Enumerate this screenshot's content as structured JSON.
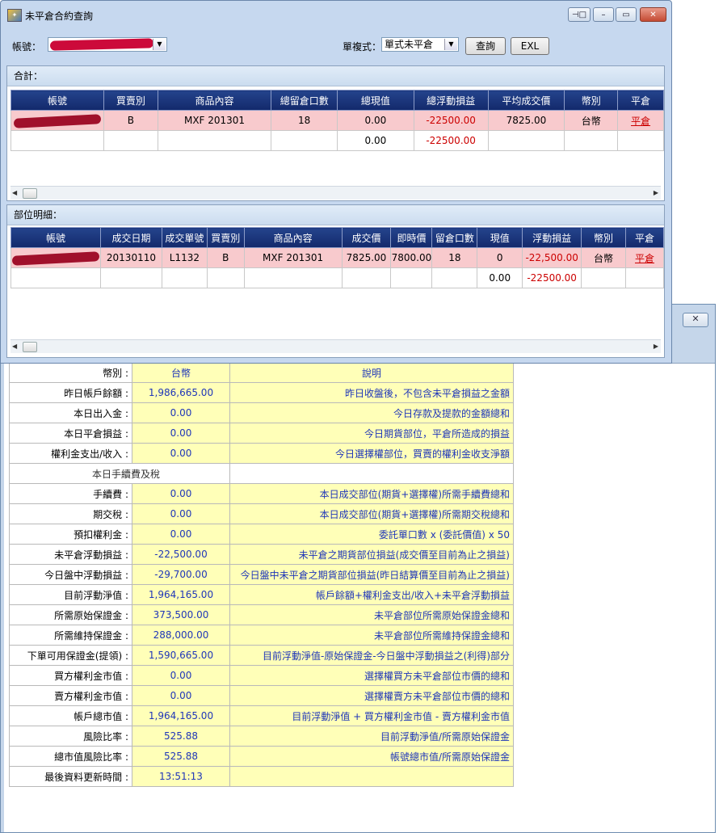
{
  "dialog": {
    "title": "未平倉合約查詢",
    "account_label": "帳號：",
    "mode_label": "單複式：",
    "mode_value": "單式未平倉",
    "query_button": "查詢",
    "exl_button": "EXL",
    "window_buttons": {
      "pin": "⊣□",
      "min": "–",
      "max": "▭",
      "close": "✕"
    }
  },
  "summary_panel": {
    "title": "合計：",
    "headers": [
      "帳號",
      "買賣別",
      "商品內容",
      "總留倉口數",
      "總現值",
      "總浮動損益",
      "平均成交價",
      "幣別",
      "平倉"
    ],
    "rows": [
      {
        "side": "B",
        "product": "MXF 201301",
        "qty": "18",
        "value": "0.00",
        "pnl": "-22500.00",
        "avg_price": "7825.00",
        "currency": "台幣",
        "close": "平倉"
      },
      {
        "side": "",
        "product": "",
        "qty": "",
        "value": "0.00",
        "pnl": "-22500.00",
        "avg_price": "",
        "currency": "",
        "close": ""
      }
    ]
  },
  "detail_panel": {
    "title": "部位明細：",
    "headers": [
      "帳號",
      "成交日期",
      "成交單號",
      "買賣別",
      "商品內容",
      "成交價",
      "即時價",
      "留倉口數",
      "現值",
      "浮動損益",
      "幣別",
      "平倉"
    ],
    "rows": [
      {
        "date": "20130110",
        "order": "L1132",
        "side": "B",
        "product": "MXF 201301",
        "price": "7825.00",
        "last": "7800.00",
        "qty": "18",
        "value": "0",
        "pnl": "-22,500.00",
        "currency": "台幣",
        "close": "平倉"
      },
      {
        "date": "",
        "order": "",
        "side": "",
        "product": "",
        "price": "",
        "last": "",
        "qty": "",
        "value": "0.00",
        "pnl": "-22500.00",
        "currency": "",
        "close": ""
      }
    ]
  },
  "account_summary": {
    "currency_header": {
      "label": "幣別",
      "value": "台幣",
      "desc": "說明"
    },
    "section_label": "本日手續費及稅",
    "rows_top": [
      {
        "label": "昨日帳戶餘額",
        "value": "1,986,665.00",
        "desc": "昨日收盤後，不包含未平倉損益之金額"
      },
      {
        "label": "本日出入金",
        "value": "0.00",
        "desc": "今日存款及提款的金額總和"
      },
      {
        "label": "本日平倉損益",
        "value": "0.00",
        "desc": "今日期貨部位，平倉所造成的損益"
      },
      {
        "label": "權利金支出/收入",
        "value": "0.00",
        "desc": "今日選擇權部位，買賣的權利金收支淨額"
      }
    ],
    "rows_bottom": [
      {
        "label": "手續費",
        "value": "0.00",
        "desc": "本日成交部位(期貨+選擇權)所需手續費總和"
      },
      {
        "label": "期交稅",
        "value": "0.00",
        "desc": "本日成交部位(期貨+選擇權)所需期交稅總和"
      },
      {
        "label": "預扣權利金",
        "value": "0.00",
        "desc": "委託單口數 x (委託價值) x 50"
      },
      {
        "label": "未平倉浮動損益",
        "value": "-22,500.00",
        "desc": "未平倉之期貨部位損益(成交價至目前為止之損益)"
      },
      {
        "label": "今日盤中浮動損益",
        "value": "-29,700.00",
        "desc": "今日盤中未平倉之期貨部位損益(昨日結算價至目前為止之損益)"
      },
      {
        "label": "目前浮動淨值",
        "value": "1,964,165.00",
        "desc": "帳戶餘額+權利金支出/收入+未平倉浮動損益"
      },
      {
        "label": "所需原始保證金",
        "value": "373,500.00",
        "desc": "未平倉部位所需原始保證金總和"
      },
      {
        "label": "所需維持保證金",
        "value": "288,000.00",
        "desc": "未平倉部位所需維持保證金總和"
      },
      {
        "label": "下單可用保證金(提領)",
        "value": "1,590,665.00",
        "desc": "目前浮動淨值-原始保證金-今日盤中浮動損益之(利得)部分"
      },
      {
        "label": "買方權利金市值",
        "value": "0.00",
        "desc": "選擇權買方未平倉部位市價的總和"
      },
      {
        "label": "賣方權利金市值",
        "value": "0.00",
        "desc": "選擇權賣方未平倉部位市價的總和"
      },
      {
        "label": "帳戶總市值",
        "value": "1,964,165.00",
        "desc": "目前浮動淨值 + 買方權利金市值 - 賣方權利金市值"
      },
      {
        "label": "風險比率",
        "value": "525.88",
        "desc": "目前浮動淨值/所需原始保證金"
      },
      {
        "label": "總市值風險比率",
        "value": "525.88",
        "desc": "帳號總市值/所需原始保證金"
      },
      {
        "label": "最後資料更新時間",
        "value": "13:51:13",
        "desc": ""
      }
    ]
  },
  "colors": {
    "header_bg": "#13296b",
    "highlight_row": "#f8cacd",
    "value_bg": "#ffffb8",
    "value_text": "#1f36b8",
    "loss_text": "#cc0000"
  }
}
